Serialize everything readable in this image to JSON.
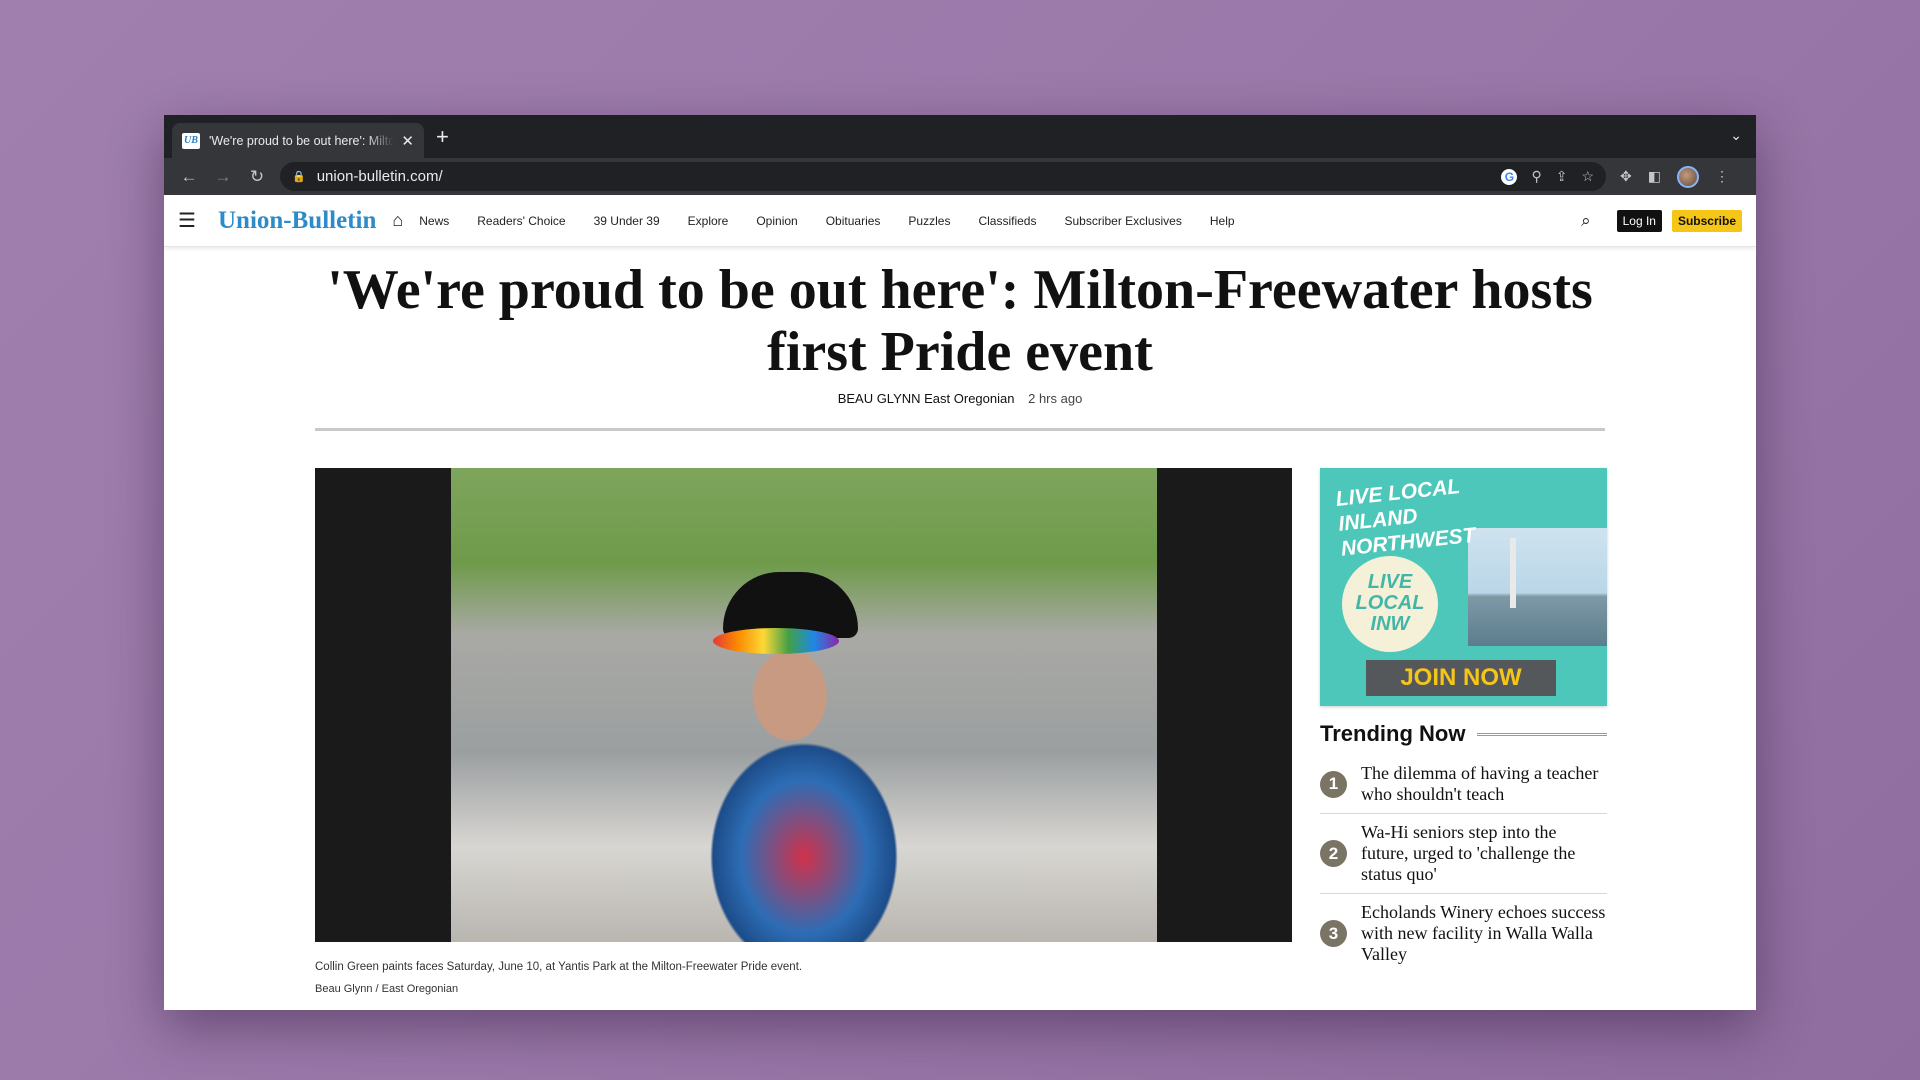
{
  "browser": {
    "tab_title": "'We're proud to be out here': Milton-Freewater hosts first Pride event",
    "tab_favicon": "UB",
    "url": "union-bulletin.com/"
  },
  "site": {
    "logo": "Union-Bulletin",
    "nav": [
      "News",
      "Readers' Choice",
      "39 Under 39",
      "Explore",
      "Opinion",
      "Obituaries",
      "Puzzles",
      "Classifieds",
      "Subscriber Exclusives",
      "Help"
    ],
    "login_label": "Log In",
    "subscribe_label": "Subscribe"
  },
  "article": {
    "headline": "'We're proud to be out here': Milton-Freewater hosts first Pride event",
    "author": "BEAU GLYNN East Oregonian",
    "time": "2 hrs ago",
    "caption": "Collin Green paints faces Saturday, June 10, at Yantis Park at the Milton-Freewater Pride event.",
    "credit": "Beau Glynn / East Oregonian"
  },
  "ad": {
    "title": "Live Local Inland Northwest",
    "badge": "Live Local INW",
    "cta": "JOIN NOW",
    "accent": "#4cc7b9"
  },
  "trending": {
    "title": "Trending Now",
    "items": [
      {
        "num": "1",
        "text": "The dilemma of having a teacher who shouldn't teach"
      },
      {
        "num": "2",
        "text": "Wa-Hi seniors step into the future, urged to 'challenge the status quo'"
      },
      {
        "num": "3",
        "text": "Echolands Winery echoes success with new facility in Walla Walla Valley"
      }
    ]
  },
  "colors": {
    "brand": "#2d8bc9",
    "subscribe": "#f5c518"
  }
}
